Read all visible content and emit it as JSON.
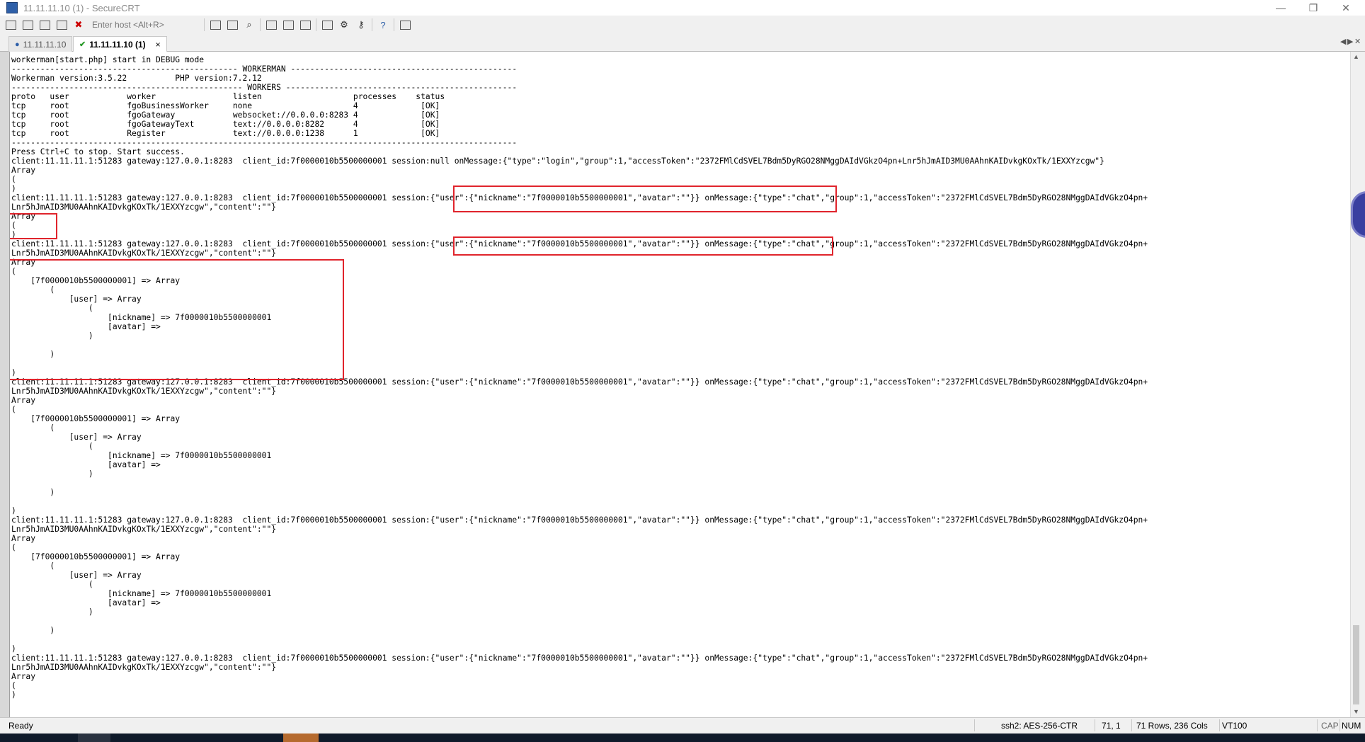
{
  "window": {
    "title": "11.11.11.10 (1) - SecureCRT",
    "controls": {
      "minimize": "—",
      "restore": "❐",
      "close": "✕"
    }
  },
  "toolbar": {
    "host_placeholder": "Enter host <Alt+R>",
    "icons": [
      "connect-icon",
      "quick-connect-icon",
      "connect-tab-icon",
      "reconnect-icon",
      "disconnect-icon",
      "copy-icon",
      "paste-icon",
      "find-icon",
      "print-icon",
      "print-selection-icon",
      "print-screen-icon",
      "session-options-icon",
      "global-options-icon",
      "key-map-icon",
      "help-icon",
      "screenshot-icon"
    ]
  },
  "tabs": [
    {
      "label": "11.11.11.10",
      "active": false,
      "icon": "info-dot-icon"
    },
    {
      "label": "11.11.11.10 (1)",
      "active": true,
      "icon": "checkmark-icon",
      "close": "×"
    }
  ],
  "tab_nav": {
    "left": "◀",
    "right": "▶",
    "close": "✕"
  },
  "terminal": {
    "lines": [
      "workerman[start.php] start in DEBUG mode",
      "----------------------------------------------- WORKERMAN -----------------------------------------------",
      "Workerman version:3.5.22          PHP version:7.2.12",
      "------------------------------------------------ WORKERS ------------------------------------------------",
      "proto   user            worker                listen                   processes    status",
      "tcp     root            fgoBusinessWorker     none                     4             [OK]",
      "tcp     root            fgoGateway            websocket://0.0.0.0:8283 4             [OK]",
      "tcp     root            fgoGatewayText        text://0.0.0.0:8282      4             [OK]",
      "tcp     root            Register              text://0.0.0.0:1238      1             [OK]",
      "---------------------------------------------------------------------------------------------------------",
      "Press Ctrl+C to stop. Start success.",
      "client:11.11.11.1:51283 gateway:127.0.0.1:8283  client_id:7f0000010b5500000001 session:null onMessage:{\"type\":\"login\",\"group\":1,\"accessToken\":\"2372FMlCdSVEL7Bdm5DyRGO28NMggDAIdVGkzO4pn+Lnr5hJmAID3MU0AAhnKAIDvkgKOxTk/1EXXYzcgw\"}",
      "Array",
      "(",
      ")",
      "client:11.11.11.1:51283 gateway:127.0.0.1:8283  client_id:7f0000010b5500000001 session:{\"user\":{\"nickname\":\"7f0000010b5500000001\",\"avatar\":\"\"}} onMessage:{\"type\":\"chat\",\"group\":1,\"accessToken\":\"2372FMlCdSVEL7Bdm5DyRGO28NMggDAIdVGkzO4pn+",
      "Lnr5hJmAID3MU0AAhnKAIDvkgKOxTk/1EXXYzcgw\",\"content\":\"\"}",
      "Array",
      "(",
      ")",
      "client:11.11.11.1:51283 gateway:127.0.0.1:8283  client_id:7f0000010b5500000001 session:{\"user\":{\"nickname\":\"7f0000010b5500000001\",\"avatar\":\"\"}} onMessage:{\"type\":\"chat\",\"group\":1,\"accessToken\":\"2372FMlCdSVEL7Bdm5DyRGO28NMggDAIdVGkzO4pn+",
      "Lnr5hJmAID3MU0AAhnKAIDvkgKOxTk/1EXXYzcgw\",\"content\":\"\"}",
      "Array",
      "(",
      "    [7f0000010b5500000001] => Array",
      "        (",
      "            [user] => Array",
      "                (",
      "                    [nickname] => 7f0000010b5500000001",
      "                    [avatar] =>",
      "                )",
      "",
      "        )",
      "",
      ")",
      "client:11.11.11.1:51283 gateway:127.0.0.1:8283  client_id:7f0000010b5500000001 session:{\"user\":{\"nickname\":\"7f0000010b5500000001\",\"avatar\":\"\"}} onMessage:{\"type\":\"chat\",\"group\":1,\"accessToken\":\"2372FMlCdSVEL7Bdm5DyRGO28NMggDAIdVGkzO4pn+",
      "Lnr5hJmAID3MU0AAhnKAIDvkgKOxTk/1EXXYzcgw\",\"content\":\"\"}",
      "Array",
      "(",
      "    [7f0000010b5500000001] => Array",
      "        (",
      "            [user] => Array",
      "                (",
      "                    [nickname] => 7f0000010b5500000001",
      "                    [avatar] =>",
      "                )",
      "",
      "        )",
      "",
      ")",
      "client:11.11.11.1:51283 gateway:127.0.0.1:8283  client_id:7f0000010b5500000001 session:{\"user\":{\"nickname\":\"7f0000010b5500000001\",\"avatar\":\"\"}} onMessage:{\"type\":\"chat\",\"group\":1,\"accessToken\":\"2372FMlCdSVEL7Bdm5DyRGO28NMggDAIdVGkzO4pn+",
      "Lnr5hJmAID3MU0AAhnKAIDvkgKOxTk/1EXXYzcgw\",\"content\":\"\"}",
      "Array",
      "(",
      "    [7f0000010b5500000001] => Array",
      "        (",
      "            [user] => Array",
      "                (",
      "                    [nickname] => 7f0000010b5500000001",
      "                    [avatar] =>",
      "                )",
      "",
      "        )",
      "",
      ")",
      "client:11.11.11.1:51283 gateway:127.0.0.1:8283  client_id:7f0000010b5500000001 session:{\"user\":{\"nickname\":\"7f0000010b5500000001\",\"avatar\":\"\"}} onMessage:{\"type\":\"chat\",\"group\":1,\"accessToken\":\"2372FMlCdSVEL7Bdm5DyRGO28NMggDAIdVGkzO4pn+",
      "Lnr5hJmAID3MU0AAhnKAIDvkgKOxTk/1EXXYzcgw\",\"content\":\"\"}",
      "Array",
      "(",
      ")"
    ]
  },
  "statusbar": {
    "ready": "Ready",
    "encryption": "ssh2: AES-256-CTR",
    "cursor": "71,  1",
    "size": "71 Rows, 236 Cols",
    "emulation": "VT100",
    "cap": "CAP",
    "num": "NUM"
  },
  "colors": {
    "highlight": "#e0242c",
    "terminal_bg": "#ffffff",
    "chrome": "#f0f0f0"
  }
}
